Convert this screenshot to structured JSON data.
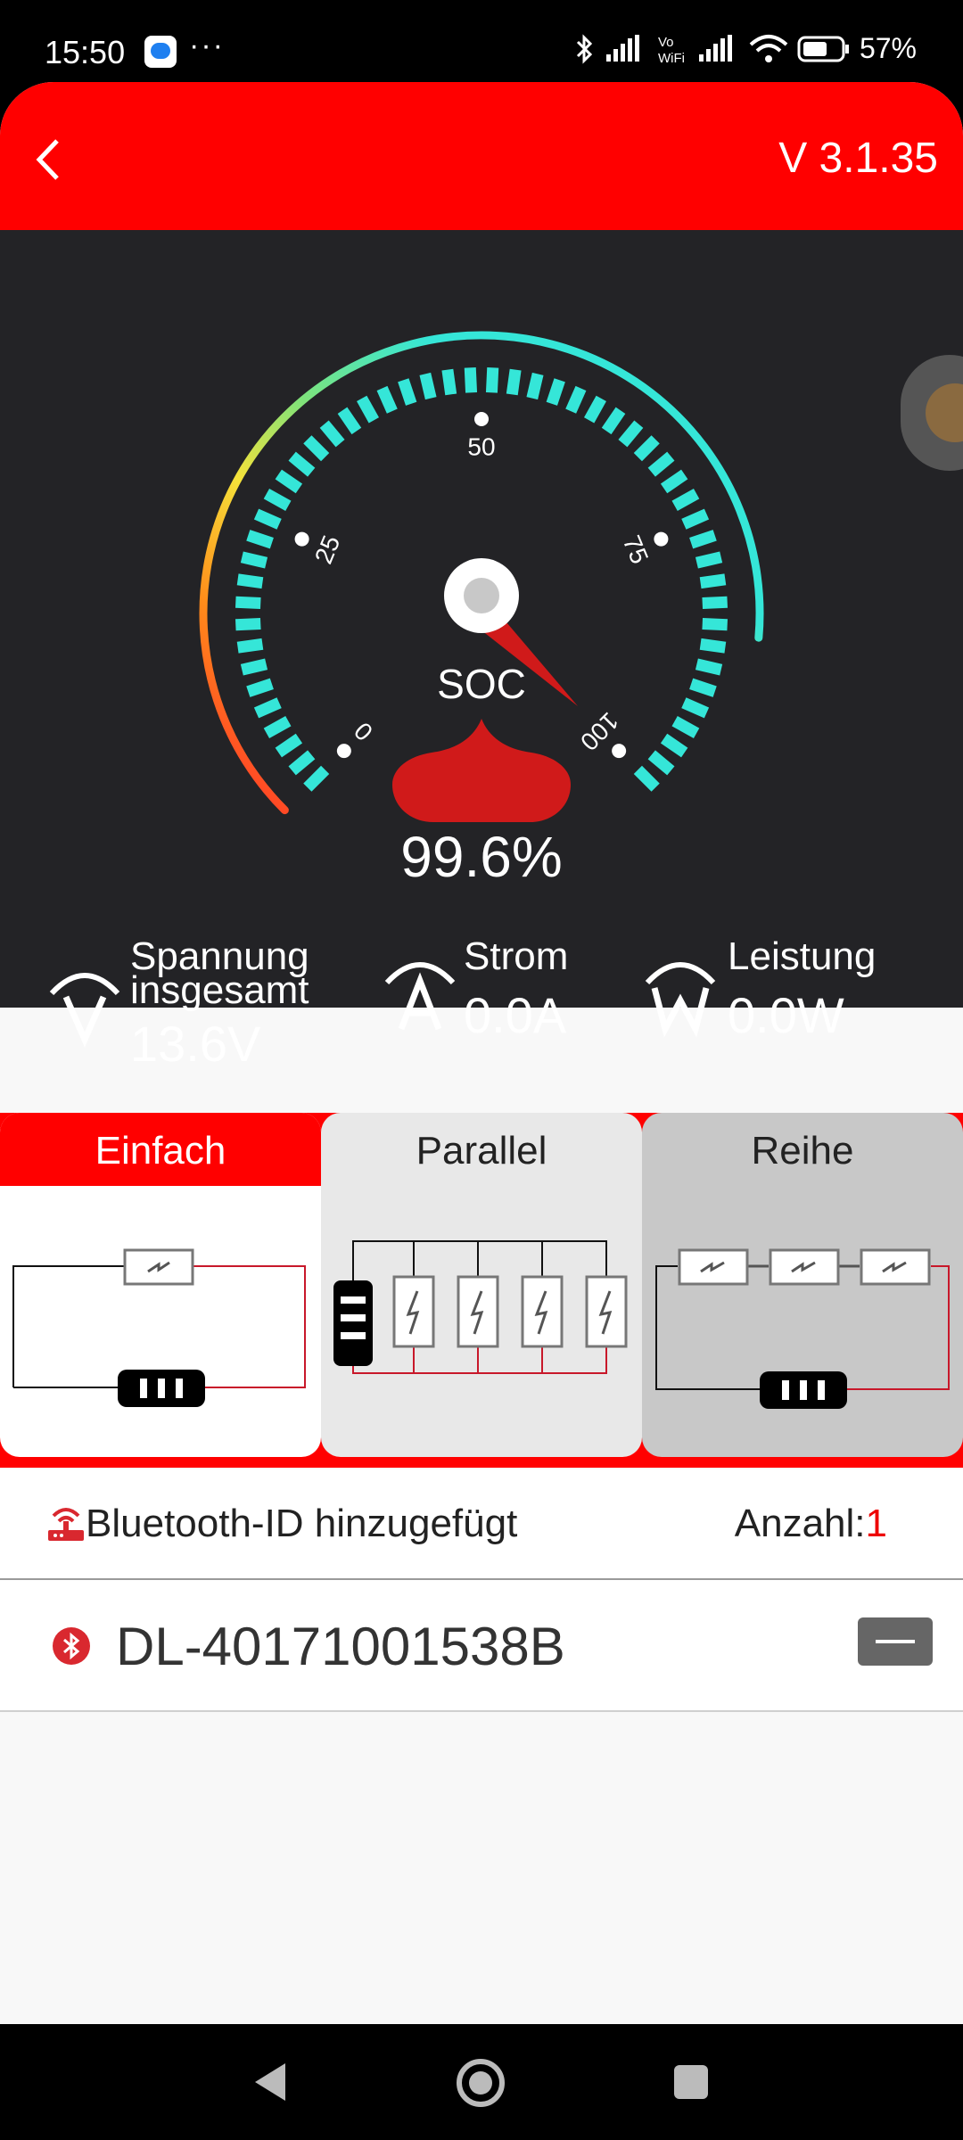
{
  "status_bar": {
    "time": "15:50",
    "dots": "···",
    "battery": "57%"
  },
  "header": {
    "version": "V 3.1.35"
  },
  "gauge": {
    "ticks": [
      "0",
      "25",
      "50",
      "75",
      "100"
    ],
    "center_label": "SOC",
    "soc_value": "99.6%",
    "soc_percent": 99.6
  },
  "metrics": {
    "voltage": {
      "label_1": "Spannung",
      "label_2": "insgesamt",
      "value": "13.6V",
      "icon": "voltage-icon"
    },
    "current": {
      "label": "Strom",
      "value": "0.0A",
      "icon": "current-icon"
    },
    "power": {
      "label": "Leistung",
      "value": "0.0W",
      "icon": "power-icon"
    }
  },
  "tabs": [
    {
      "label": "Einfach",
      "active": true
    },
    {
      "label": "Parallel",
      "active": false
    },
    {
      "label": "Reihe",
      "active": false
    }
  ],
  "bluetooth": {
    "title": "Bluetooth-ID hinzugefügt",
    "count_label": "Anzahl:",
    "count": "1",
    "devices": [
      {
        "name": "DL-40171001538B"
      }
    ]
  },
  "colors": {
    "accent": "#ff0000",
    "gauge_teal": "#35e6d8",
    "dash_bg": "#232326"
  }
}
